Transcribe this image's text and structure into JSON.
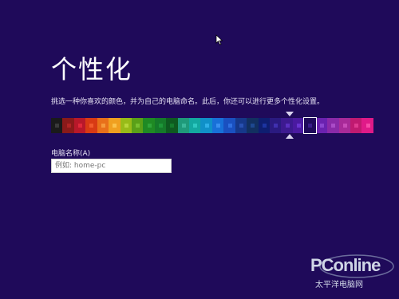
{
  "title": "个性化",
  "description": "挑选一种你喜欢的颜色，并为自己的电脑命名。此后，你还可以进行更多个性化设置。",
  "color_picker": {
    "selected_index": 22,
    "swatches": [
      {
        "bg": "#1a1a1a",
        "dot": "#3a3a3a"
      },
      {
        "bg": "#8a1a1a",
        "dot": "#b02424"
      },
      {
        "bg": "#b8182a",
        "dot": "#e0283a"
      },
      {
        "bg": "#d83a14",
        "dot": "#f05a2c"
      },
      {
        "bg": "#e8701a",
        "dot": "#f59a3c"
      },
      {
        "bg": "#f0a020",
        "dot": "#fbc24a"
      },
      {
        "bg": "#98bb18",
        "dot": "#b8d63a"
      },
      {
        "bg": "#5aa018",
        "dot": "#78c030"
      },
      {
        "bg": "#1f8a24",
        "dot": "#2fa63a"
      },
      {
        "bg": "#157a2a",
        "dot": "#1d9638"
      },
      {
        "bg": "#0e5a20",
        "dot": "#147a2c"
      },
      {
        "bg": "#1f9a7a",
        "dot": "#3ab89a"
      },
      {
        "bg": "#13a8a0",
        "dot": "#2ec8c0"
      },
      {
        "bg": "#1090c8",
        "dot": "#30b0e8"
      },
      {
        "bg": "#1870d8",
        "dot": "#3a90f0"
      },
      {
        "bg": "#1a50c0",
        "dot": "#3070e0"
      },
      {
        "bg": "#16388a",
        "dot": "#2850b0"
      },
      {
        "bg": "#123060",
        "dot": "#1e4890"
      },
      {
        "bg": "#0e1e70",
        "dot": "#1c34a0"
      },
      {
        "bg": "#2a1a80",
        "dot": "#4030b0"
      },
      {
        "bg": "#3d1a90",
        "dot": "#5a30c0"
      },
      {
        "bg": "#4a1aa0",
        "dot": "#6a34d0"
      },
      {
        "bg": "#1f0a5a",
        "dot": "#3a1c8a"
      },
      {
        "bg": "#6a22b0",
        "dot": "#8a44d0"
      },
      {
        "bg": "#8a2aa8",
        "dot": "#aa4cc8"
      },
      {
        "bg": "#a82a98",
        "dot": "#c84cb8"
      },
      {
        "bg": "#c01a70",
        "dot": "#e03a90"
      },
      {
        "bg": "#e01a88",
        "dot": "#f84aa8"
      }
    ]
  },
  "computer_name": {
    "label": "电脑名称(A)",
    "placeholder": "例如: home-pc",
    "value": ""
  },
  "watermark": {
    "logo": "PConline",
    "subtitle": "太平洋电脑网"
  }
}
